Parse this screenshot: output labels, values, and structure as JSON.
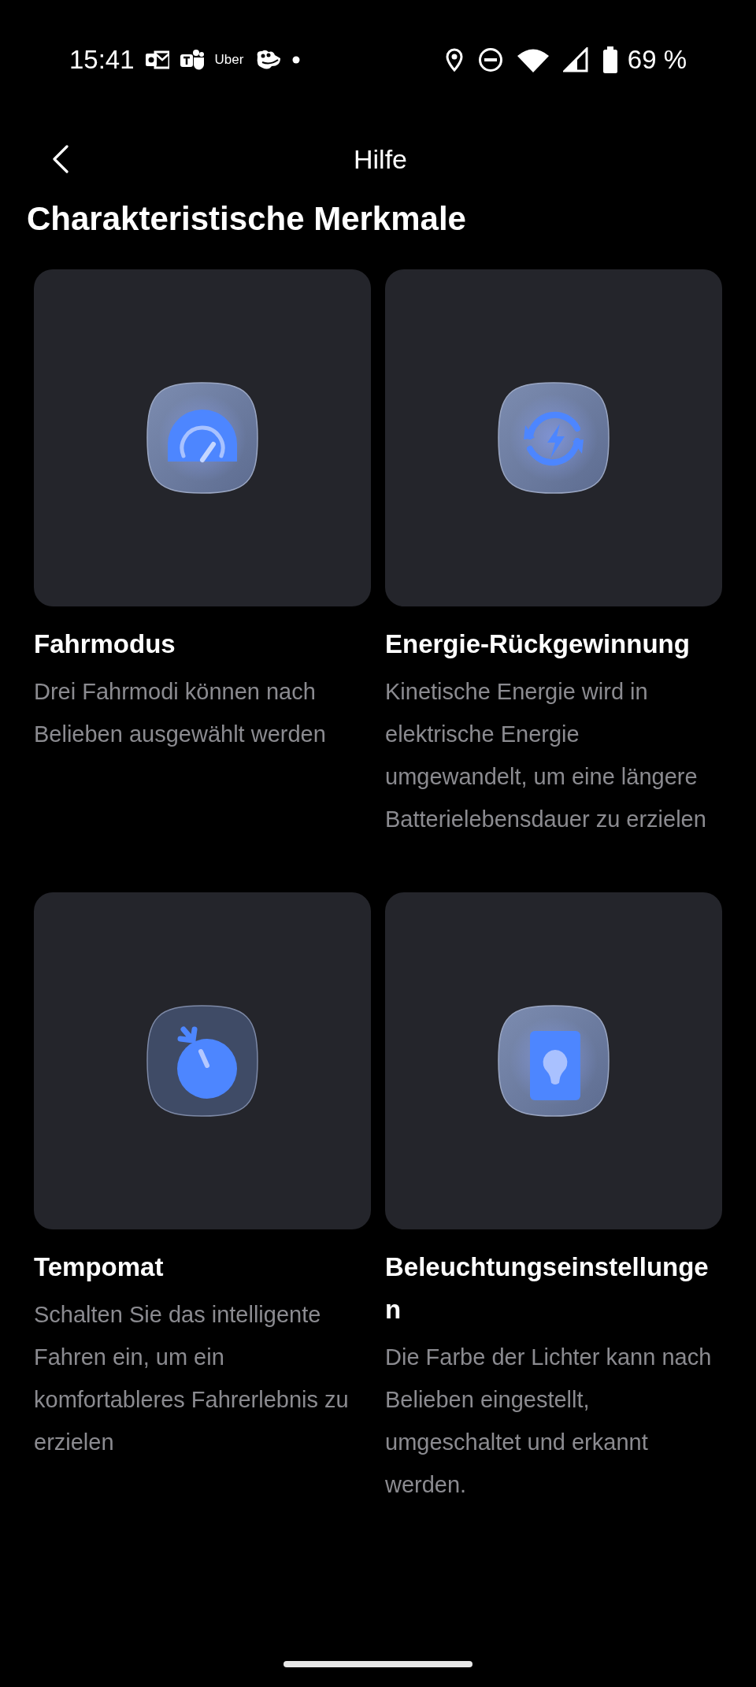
{
  "status_bar": {
    "time": "15:41",
    "notification_text": "Uber",
    "battery": "69 %"
  },
  "header": {
    "title": "Hilfe"
  },
  "section_title": "Charakteristische Merkmale",
  "features": [
    {
      "title": "Fahrmodus",
      "description": "Drei Fahrmodi können nach Belieben ausgewählt werden"
    },
    {
      "title": "Energie-Rückgewinnung",
      "description": "Kinetische Energie wird in elektrische Energie umgewandelt, um eine längere Batterielebensdauer zu erzielen"
    },
    {
      "title": "Tempomat",
      "description": "Schalten Sie das intelligente Fahren ein, um ein komfortableres Fahrerlebnis zu erzielen"
    },
    {
      "title": "Beleuchtungseinstellungen",
      "description": "Die Farbe der Lichter kann nach Belieben eingestellt, umgeschaltet und erkannt werden."
    }
  ]
}
